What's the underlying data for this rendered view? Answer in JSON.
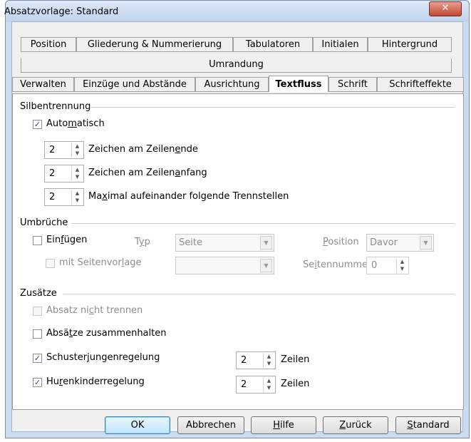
{
  "window": {
    "title": "Absatzvorlage: Standard",
    "close_glyph": "✕"
  },
  "tabs": {
    "row1": [
      "Position",
      "Gliederung & Nummerierung",
      "Tabulatoren",
      "Initialen",
      "Hintergrund"
    ],
    "row2": [
      "Umrandung"
    ],
    "row3": [
      "Verwalten",
      "Einzüge und Abstände",
      "Ausrichtung",
      "Textfluss",
      "Schrift",
      "Schrifteffekte"
    ],
    "active": "Textfluss"
  },
  "silbentrennung": {
    "heading": "Silbentrennung",
    "automatisch": {
      "pre": "Auto",
      "u": "m",
      "post": "atisch",
      "checked": true
    },
    "zeilenende": {
      "value": "2",
      "pre": "Zeichen am Zeilen",
      "u": "e",
      "post": "nde"
    },
    "zeilenanfang": {
      "value": "2",
      "pre": "Zeichen am Zeilen",
      "u": "a",
      "post": "nfang"
    },
    "trennstellen": {
      "value": "2",
      "pre": "Ma",
      "u": "x",
      "post": "imal aufeinander folgende Trennstellen"
    }
  },
  "umbrueche": {
    "heading": "Umbrüche",
    "einfuegen": {
      "pre": "Ein",
      "u": "f",
      "post": "ügen",
      "checked": false
    },
    "typ": {
      "pre": "T",
      "u": "y",
      "post": "p",
      "value": "Seite"
    },
    "position": {
      "u": "P",
      "post": "osition",
      "value": "Davor"
    },
    "seitenvorlage": {
      "pre": "mit Seitenvor",
      "u": "l",
      "post": "age",
      "checked": false,
      "value": ""
    },
    "seitennummer": {
      "pre": "Se",
      "u": "i",
      "post": "tennummer",
      "value": "0"
    }
  },
  "zusaetze": {
    "heading": "Zusätze",
    "nicht_trennen": {
      "pre": "Absatz ni",
      "u": "c",
      "post": "ht trennen",
      "checked": false
    },
    "zusammenhalten": {
      "pre": "Absä",
      "u": "t",
      "post": "ze zusammenhalten",
      "checked": false
    },
    "schusterjungen": {
      "pre": "Schuster",
      "u": "j",
      "post": "ungenregelung",
      "checked": true,
      "value": "2",
      "unit": "Zeilen"
    },
    "hurenkinder": {
      "pre": "Hu",
      "u": "r",
      "post": "enkinderregelung",
      "checked": true,
      "value": "2",
      "unit": "Zeilen"
    }
  },
  "buttons": {
    "ok": "OK",
    "abbrechen": "Abbrechen",
    "hilfe": {
      "u": "H",
      "post": "ilfe"
    },
    "zurueck": {
      "u": "Z",
      "post": "urück"
    },
    "standard": {
      "u": "S",
      "post": "tandard"
    }
  },
  "glyphs": {
    "check": "✓",
    "up": "▲",
    "down": "▼",
    "dropdown": "▼"
  }
}
